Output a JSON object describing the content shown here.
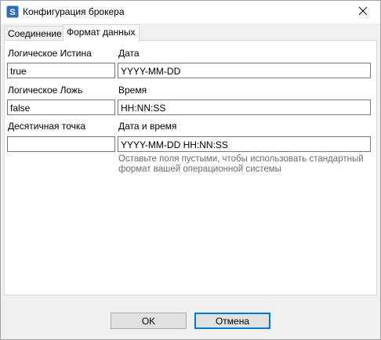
{
  "window": {
    "title": "Конфигурация брокера",
    "icon": "app-logo-icon"
  },
  "tabs": [
    {
      "label": "Соединение",
      "active": false
    },
    {
      "label": "Формат данных",
      "active": true
    }
  ],
  "form": {
    "logical_true": {
      "label": "Логическое Истина",
      "value": "true"
    },
    "logical_false": {
      "label": "Логическое Ложь",
      "value": "false"
    },
    "decimal_point": {
      "label": "Десятичная точка",
      "value": ""
    },
    "date": {
      "label": "Дата",
      "value": "YYYY-MM-DD"
    },
    "time": {
      "label": "Время",
      "value": "HH:NN:SS"
    },
    "datetime": {
      "label": "Дата и время",
      "value": "YYYY-MM-DD HH:NN:SS"
    },
    "hint": "Оставьте поля пустыми, чтобы использовать стандартный формат вашей операционной системы"
  },
  "buttons": {
    "ok": "OK",
    "cancel": "Отмена"
  },
  "colors": {
    "accent": "#0078d7",
    "panel": "#ffffff",
    "dialog": "#f0f0f0"
  }
}
